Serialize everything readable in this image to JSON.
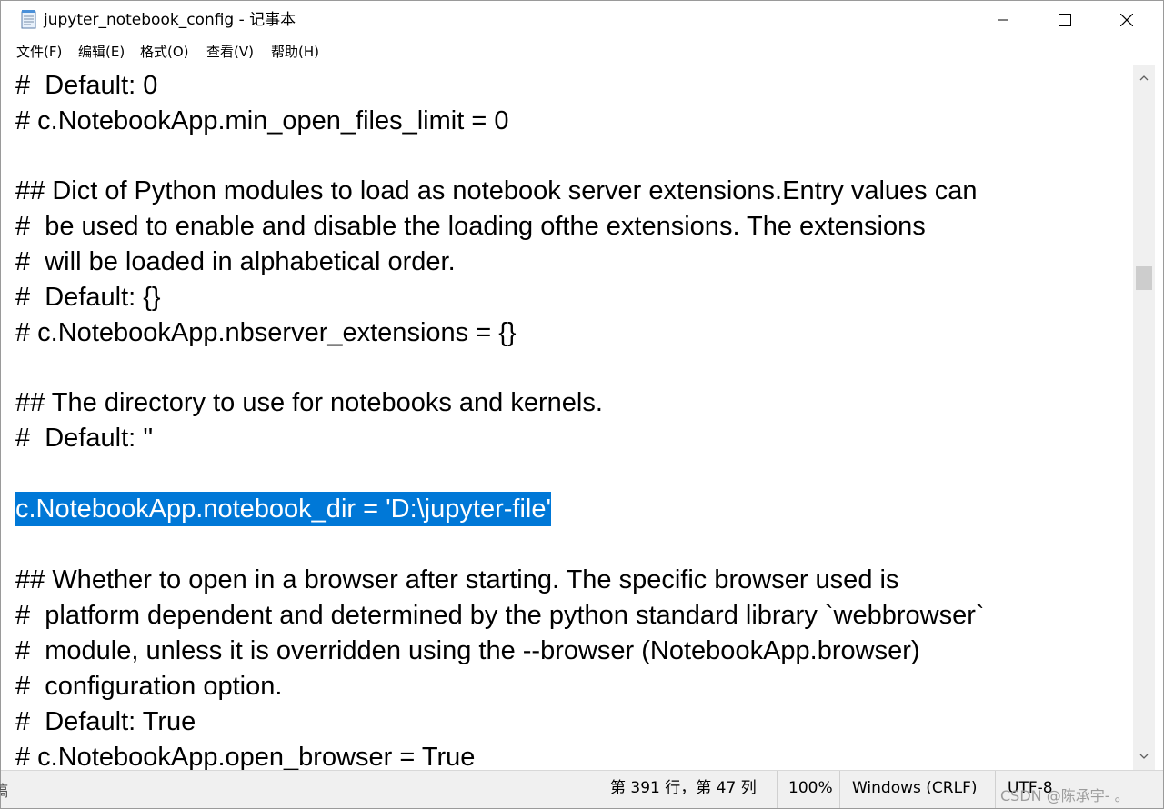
{
  "window": {
    "title": "jupyter_notebook_config - 记事本",
    "icon": "notepad-icon"
  },
  "menu": [
    {
      "label": "文件(F)"
    },
    {
      "label": "编辑(E)"
    },
    {
      "label": "格式(O)"
    },
    {
      "label": "查看(V)"
    },
    {
      "label": "帮助(H)"
    }
  ],
  "editor": {
    "lines": [
      {
        "text": "#  Default: 0"
      },
      {
        "text": "# c.NotebookApp.min_open_files_limit = 0"
      },
      {
        "text": ""
      },
      {
        "text": "## Dict of Python modules to load as notebook server extensions.Entry values can"
      },
      {
        "text": "#  be used to enable and disable the loading ofthe extensions. The extensions"
      },
      {
        "text": "#  will be loaded in alphabetical order."
      },
      {
        "text": "#  Default: {}"
      },
      {
        "text": "# c.NotebookApp.nbserver_extensions = {}"
      },
      {
        "text": ""
      },
      {
        "text": "## The directory to use for notebooks and kernels."
      },
      {
        "text": "#  Default: ''"
      },
      {
        "text": ""
      },
      {
        "text": "c.NotebookApp.notebook_dir = 'D:\\jupyter-file'",
        "selected": true
      },
      {
        "text": ""
      },
      {
        "text": "## Whether to open in a browser after starting. The specific browser used is"
      },
      {
        "text": "#  platform dependent and determined by the python standard library `webbrowser`"
      },
      {
        "text": "#  module, unless it is overridden using the --browser (NotebookApp.browser)"
      },
      {
        "text": "#  configuration option."
      },
      {
        "text": "#  Default: True"
      },
      {
        "text": "# c.NotebookApp.open_browser = True"
      }
    ],
    "selection_color": "#0078d7"
  },
  "status": {
    "position": "第 391 行，第 47 列",
    "zoom": "100%",
    "line_ending": "Windows (CRLF)",
    "encoding": "UTF-8"
  },
  "watermark": "CSDN @陈承宇- 。",
  "left_edge_char": "稿"
}
